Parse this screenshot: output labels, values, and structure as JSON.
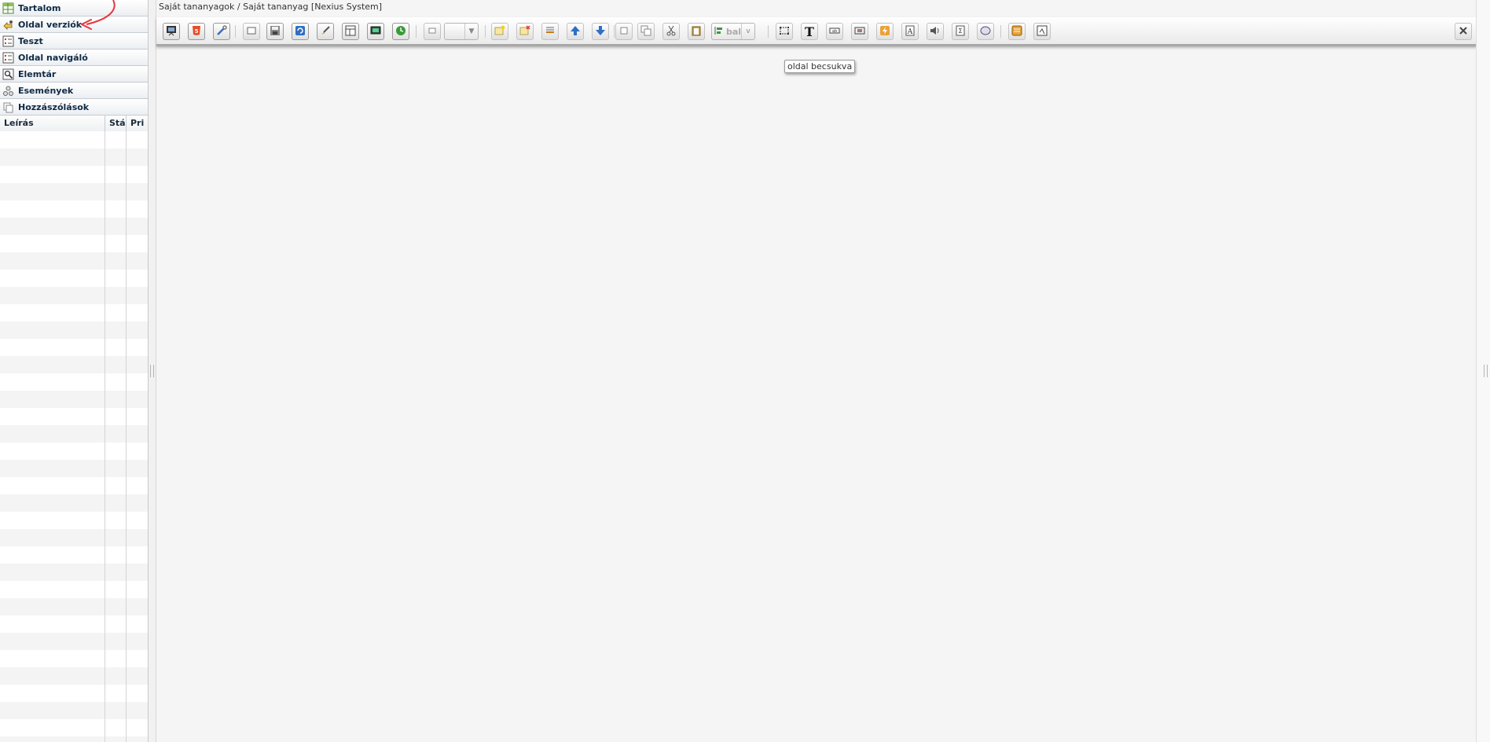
{
  "sidebar": {
    "items": [
      {
        "label": "Tartalom",
        "icon": "grid-table-icon"
      },
      {
        "label": "Oldal verziók",
        "icon": "versions-icon"
      },
      {
        "label": "Teszt",
        "icon": "test-list-icon"
      },
      {
        "label": "Oldal navigáló",
        "icon": "page-navigator-icon"
      },
      {
        "label": "Elemtár",
        "icon": "element-library-icon"
      },
      {
        "label": "Események",
        "icon": "events-icon"
      },
      {
        "label": "Hozzászólások",
        "icon": "comments-icon"
      }
    ],
    "grid": {
      "columns": [
        "Leírás",
        "Stá",
        "Pri"
      ]
    }
  },
  "main": {
    "breadcrumb": "Saját tananyagok / Saját tananyag [Nexius System]",
    "toolbar": {
      "align_dropdown_value": "bal",
      "buttons": [
        "presentation-icon",
        "html5-icon",
        "tools-icon",
        "blank-page-icon",
        "save-icon",
        "refresh-icon",
        "brush-icon",
        "layout-icon",
        "screen-icon",
        "clock-icon",
        "small-box-icon",
        "add-note-icon",
        "delete-note-icon",
        "layers-icon",
        "arrow-up-icon",
        "arrow-down-icon",
        "copy-icon",
        "duplicate-icon",
        "cut-icon",
        "paste-icon",
        "select-frame-icon",
        "text-icon",
        "textfield-icon",
        "image-box-icon",
        "flash-icon",
        "font-icon",
        "audio-icon",
        "formula-icon",
        "shape-icon",
        "panel-icon",
        "preview-icon",
        "close-icon"
      ]
    },
    "tooltip": "oldal becsukva"
  },
  "colors": {
    "accent_red": "#e8353b",
    "sidebar_text": "#0f2a44",
    "toolbar_blue": "#2f6fc4"
  }
}
